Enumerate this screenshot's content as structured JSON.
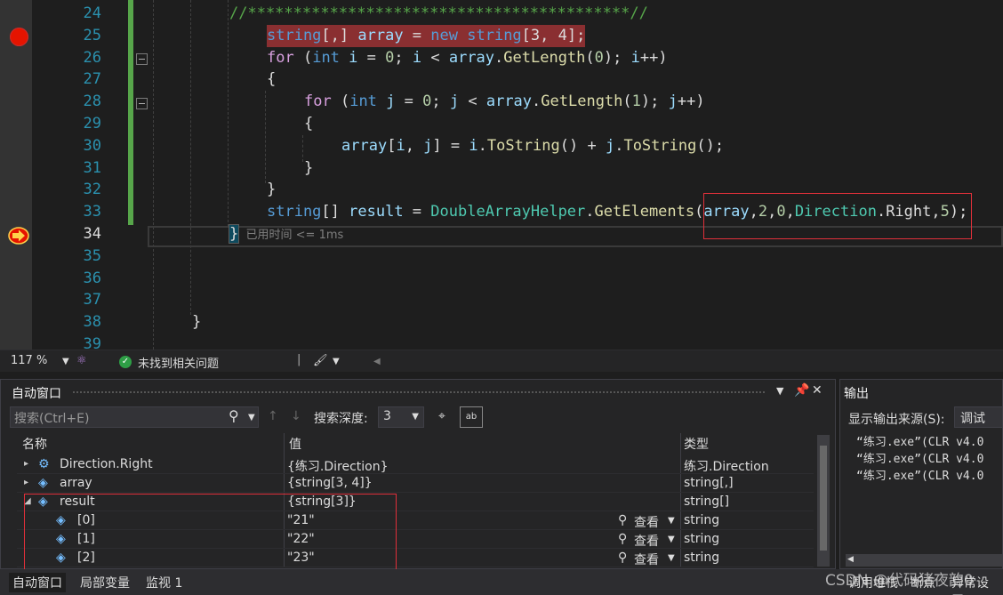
{
  "editor": {
    "lines": [
      {
        "no": "24",
        "segments": [
          {
            "t": "//******************************************//",
            "c": "cm"
          }
        ],
        "indent": 216
      },
      {
        "no": "25",
        "segments": [
          {
            "t": "string",
            "c": "kw"
          },
          {
            "t": "[,] ",
            "c": "plain"
          },
          {
            "t": "array",
            "c": "loc"
          },
          {
            "t": " = ",
            "c": "plain"
          },
          {
            "t": "new",
            "c": "kw"
          },
          {
            "t": " ",
            "c": "plain"
          },
          {
            "t": "string",
            "c": "kw"
          },
          {
            "t": "[3, 4];",
            "c": "plain"
          }
        ],
        "indent": 258
      },
      {
        "no": "26",
        "segments": [
          {
            "t": "for",
            "c": "ctl"
          },
          {
            "t": " (",
            "c": "plain"
          },
          {
            "t": "int",
            "c": "kw"
          },
          {
            "t": " ",
            "c": "plain"
          },
          {
            "t": "i",
            "c": "loc"
          },
          {
            "t": " = ",
            "c": "plain"
          },
          {
            "t": "0",
            "c": "num"
          },
          {
            "t": "; ",
            "c": "plain"
          },
          {
            "t": "i",
            "c": "loc"
          },
          {
            "t": " < ",
            "c": "plain"
          },
          {
            "t": "array",
            "c": "loc"
          },
          {
            "t": ".",
            "c": "plain"
          },
          {
            "t": "GetLength",
            "c": "fn"
          },
          {
            "t": "(",
            "c": "plain"
          },
          {
            "t": "0",
            "c": "num"
          },
          {
            "t": "); ",
            "c": "plain"
          },
          {
            "t": "i",
            "c": "loc"
          },
          {
            "t": "++)",
            "c": "plain"
          }
        ],
        "indent": 258
      },
      {
        "no": "27",
        "segments": [
          {
            "t": "{",
            "c": "plain"
          }
        ],
        "indent": 258
      },
      {
        "no": "28",
        "segments": [
          {
            "t": "for",
            "c": "ctl"
          },
          {
            "t": " (",
            "c": "plain"
          },
          {
            "t": "int",
            "c": "kw"
          },
          {
            "t": " ",
            "c": "plain"
          },
          {
            "t": "j",
            "c": "loc"
          },
          {
            "t": " = ",
            "c": "plain"
          },
          {
            "t": "0",
            "c": "num"
          },
          {
            "t": "; ",
            "c": "plain"
          },
          {
            "t": "j",
            "c": "loc"
          },
          {
            "t": " < ",
            "c": "plain"
          },
          {
            "t": "array",
            "c": "loc"
          },
          {
            "t": ".",
            "c": "plain"
          },
          {
            "t": "GetLength",
            "c": "fn"
          },
          {
            "t": "(",
            "c": "plain"
          },
          {
            "t": "1",
            "c": "num"
          },
          {
            "t": "); ",
            "c": "plain"
          },
          {
            "t": "j",
            "c": "loc"
          },
          {
            "t": "++)",
            "c": "plain"
          }
        ],
        "indent": 300
      },
      {
        "no": "29",
        "segments": [
          {
            "t": "{",
            "c": "plain"
          }
        ],
        "indent": 300
      },
      {
        "no": "30",
        "segments": [
          {
            "t": "array",
            "c": "loc"
          },
          {
            "t": "[",
            "c": "plain"
          },
          {
            "t": "i",
            "c": "loc"
          },
          {
            "t": ", ",
            "c": "plain"
          },
          {
            "t": "j",
            "c": "loc"
          },
          {
            "t": "] = ",
            "c": "plain"
          },
          {
            "t": "i",
            "c": "loc"
          },
          {
            "t": ".",
            "c": "plain"
          },
          {
            "t": "ToString",
            "c": "fn"
          },
          {
            "t": "() + ",
            "c": "plain"
          },
          {
            "t": "j",
            "c": "loc"
          },
          {
            "t": ".",
            "c": "plain"
          },
          {
            "t": "ToString",
            "c": "fn"
          },
          {
            "t": "();",
            "c": "plain"
          }
        ],
        "indent": 342
      },
      {
        "no": "31",
        "segments": [
          {
            "t": "}",
            "c": "plain"
          }
        ],
        "indent": 300
      },
      {
        "no": "32",
        "segments": [
          {
            "t": "}",
            "c": "plain"
          }
        ],
        "indent": 258
      },
      {
        "no": "33",
        "segments": [
          {
            "t": "string",
            "c": "kw"
          },
          {
            "t": "[] ",
            "c": "plain"
          },
          {
            "t": "result",
            "c": "loc"
          },
          {
            "t": " = ",
            "c": "plain"
          },
          {
            "t": "DoubleArrayHelper",
            "c": "ty"
          },
          {
            "t": ".",
            "c": "plain"
          },
          {
            "t": "GetElements",
            "c": "fn"
          },
          {
            "t": "(",
            "c": "plain"
          },
          {
            "t": "array",
            "c": "loc"
          },
          {
            "t": ",",
            "c": "plain"
          },
          {
            "t": "2",
            "c": "num"
          },
          {
            "t": ",",
            "c": "plain"
          },
          {
            "t": "0",
            "c": "num"
          },
          {
            "t": ",",
            "c": "plain"
          },
          {
            "t": "Direction",
            "c": "ty"
          },
          {
            "t": ".",
            "c": "plain"
          },
          {
            "t": "Right",
            "c": "plain"
          },
          {
            "t": ",",
            "c": "plain"
          },
          {
            "t": "5",
            "c": "num"
          },
          {
            "t": ");",
            "c": "plain"
          }
        ],
        "indent": 258
      },
      {
        "no": "34",
        "segments": [],
        "indent": 216
      },
      {
        "no": "35",
        "segments": [],
        "indent": 216
      },
      {
        "no": "36",
        "segments": [],
        "indent": 216
      },
      {
        "no": "37",
        "segments": [],
        "indent": 216
      },
      {
        "no": "38",
        "segments": [
          {
            "t": "}",
            "c": "plain"
          }
        ],
        "indent": 174
      },
      {
        "no": "39",
        "segments": [],
        "indent": 216
      }
    ],
    "current_brace": "}",
    "elapsed_label": "已用时间 <= 1ms"
  },
  "edit_status": {
    "zoom": "117 %",
    "issues": "未找到相关问题"
  },
  "autos": {
    "title": "自动窗口",
    "search_placeholder": "搜索(Ctrl+E)",
    "depth_label": "搜索深度:",
    "depth_value": "3",
    "columns": {
      "name": "名称",
      "value": "值",
      "type": "类型"
    },
    "rows": [
      {
        "name": "Direction.Right",
        "value": "{练习.Direction}",
        "type": "练习.Direction",
        "expander": "▸",
        "level": 0,
        "view": ""
      },
      {
        "name": "array",
        "value": "{string[3, 4]}",
        "type": "string[,]",
        "expander": "▸",
        "level": 0,
        "view": ""
      },
      {
        "name": "result",
        "value": "{string[3]}",
        "type": "string[]",
        "expander": "◢",
        "level": 0,
        "view": ""
      },
      {
        "name": "[0]",
        "value": "\"21\"",
        "type": "string",
        "expander": "",
        "level": 1,
        "view": "查看"
      },
      {
        "name": "[1]",
        "value": "\"22\"",
        "type": "string",
        "expander": "",
        "level": 1,
        "view": "查看"
      },
      {
        "name": "[2]",
        "value": "\"23\"",
        "type": "string",
        "expander": "",
        "level": 1,
        "view": "查看"
      }
    ]
  },
  "output": {
    "title": "输出",
    "source_label": "显示输出来源(S):",
    "source_value": "调试",
    "lines": [
      "“练习.exe”(CLR v4.0",
      "“练习.exe”(CLR v4.0",
      "“练习.exe”(CLR v4.0"
    ],
    "bottom_tabs": [
      "调用堆栈",
      "断点",
      "异常设置"
    ]
  },
  "bottom_tabs": [
    "自动窗口",
    "局部变量",
    "监视 1"
  ],
  "watermark": "CSDN @代码猪夜韵0",
  "colors": {
    "breakpoint": "#e51400",
    "highlight_box": "#e0303a",
    "change_bar": "#57a64a"
  }
}
